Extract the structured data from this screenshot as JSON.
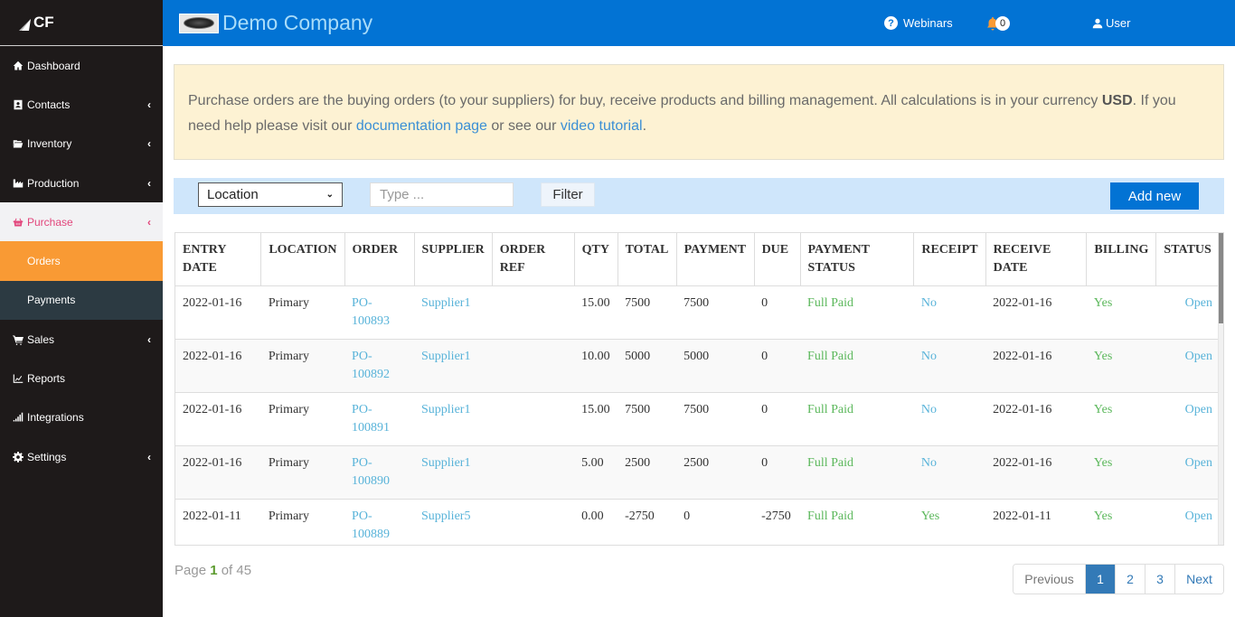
{
  "sidebar": {
    "logo_text": "CF",
    "items": [
      {
        "label": "Dashboard",
        "icon": "home-icon",
        "chevron": false
      },
      {
        "label": "Contacts",
        "icon": "contact-card-icon",
        "chevron": true
      },
      {
        "label": "Inventory",
        "icon": "folder-open-icon",
        "chevron": true
      },
      {
        "label": "Production",
        "icon": "industry-icon",
        "chevron": true
      },
      {
        "label": "Purchase",
        "icon": "basket-icon",
        "chevron": true,
        "active": true
      },
      {
        "label": "Sales",
        "icon": "cart-icon",
        "chevron": true
      },
      {
        "label": "Reports",
        "icon": "line-chart-icon",
        "chevron": false
      },
      {
        "label": "Integrations",
        "icon": "signal-icon",
        "chevron": false
      },
      {
        "label": "Settings",
        "icon": "gear-icon",
        "chevron": true
      }
    ],
    "purchase_sub": [
      {
        "label": "Orders",
        "current": true
      },
      {
        "label": "Payments",
        "current": false
      }
    ],
    "chevron_glyph": "‹"
  },
  "topbar": {
    "company_name": "Demo Company",
    "webinars_label": "Webinars",
    "notification_count": "0",
    "user_label": "User"
  },
  "alert": {
    "text_1": "Purchase orders are the buying orders (to your suppliers) for buy, receive products and billing management. All calculations is in your currency ",
    "currency": "USD",
    "text_2": ". If you need help please visit our ",
    "doc_link": "documentation page",
    "text_3": " or see our ",
    "video_link": "video tutorial",
    "text_4": "."
  },
  "filter": {
    "location_value": "Location",
    "search_placeholder": "Type ...",
    "filter_label": "Filter",
    "add_new_label": "Add new"
  },
  "table": {
    "headers": [
      "ENTRY DATE",
      "LOCATION",
      "ORDER",
      "SUPPLIER",
      "ORDER REF",
      "QTY",
      "TOTAL",
      "PAYMENT",
      "DUE",
      "PAYMENT STATUS",
      "RECEIPT",
      "RECEIVE DATE",
      "BILLING",
      "STATUS"
    ],
    "rows": [
      {
        "entry_date": "2022-01-16",
        "location": "Primary",
        "order": "PO-100893",
        "supplier": "Supplier1",
        "order_ref": "",
        "qty": "15.00",
        "total": "7500",
        "payment": "7500",
        "due": "0",
        "payment_status": "Full Paid",
        "receipt": "No",
        "receive_date": "2022-01-16",
        "billing": "Yes",
        "status": "Open"
      },
      {
        "entry_date": "2022-01-16",
        "location": "Primary",
        "order": "PO-100892",
        "supplier": "Supplier1",
        "order_ref": "",
        "qty": "10.00",
        "total": "5000",
        "payment": "5000",
        "due": "0",
        "payment_status": "Full Paid",
        "receipt": "No",
        "receive_date": "2022-01-16",
        "billing": "Yes",
        "status": "Open"
      },
      {
        "entry_date": "2022-01-16",
        "location": "Primary",
        "order": "PO-100891",
        "supplier": "Supplier1",
        "order_ref": "",
        "qty": "15.00",
        "total": "7500",
        "payment": "7500",
        "due": "0",
        "payment_status": "Full Paid",
        "receipt": "No",
        "receive_date": "2022-01-16",
        "billing": "Yes",
        "status": "Open"
      },
      {
        "entry_date": "2022-01-16",
        "location": "Primary",
        "order": "PO-100890",
        "supplier": "Supplier1",
        "order_ref": "",
        "qty": "5.00",
        "total": "2500",
        "payment": "2500",
        "due": "0",
        "payment_status": "Full Paid",
        "receipt": "No",
        "receive_date": "2022-01-16",
        "billing": "Yes",
        "status": "Open"
      },
      {
        "entry_date": "2022-01-11",
        "location": "Primary",
        "order": "PO-100889",
        "supplier": "Supplier5",
        "order_ref": "",
        "qty": "0.00",
        "total": "-2750",
        "payment": "0",
        "due": "-2750",
        "payment_status": "Full Paid",
        "receipt": "Yes",
        "receive_date": "2022-01-11",
        "billing": "Yes",
        "status": "Open"
      }
    ]
  },
  "pagination": {
    "page_prefix": "Page ",
    "current_page": "1",
    "of_text": " of 45",
    "previous_label": "Previous",
    "pages": [
      "1",
      "2",
      "3"
    ],
    "next_label": "Next"
  },
  "colors": {
    "topbar": "#0273d4",
    "sidebar": "#1e1a1a",
    "active_sub": "#f99a34",
    "link": "#58b3d9",
    "success": "#5cb85c",
    "purchase_accent": "#e2457b"
  }
}
